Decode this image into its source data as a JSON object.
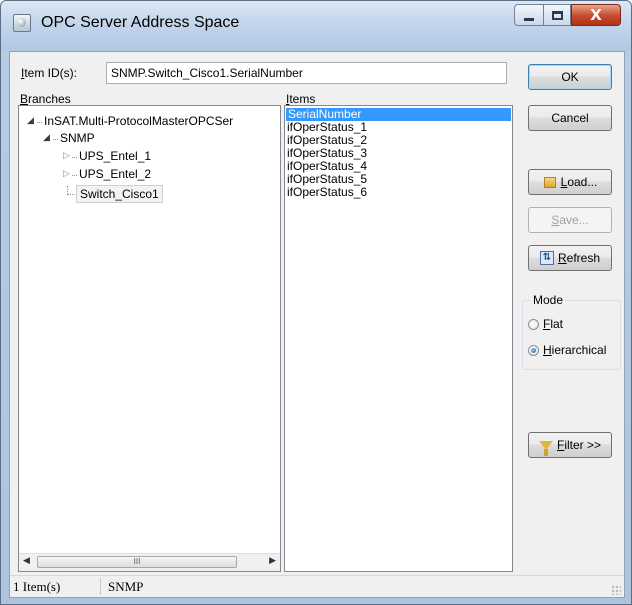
{
  "window": {
    "title": "OPC Server Address Space",
    "controls": {
      "minimize_icon": "minimize-icon",
      "maximize_icon": "maximize-icon",
      "close_glyph": "X"
    }
  },
  "item_id": {
    "label_prefix": "I",
    "label_rest": "tem ID(s):",
    "value": "SNMP.Switch_Cisco1.SerialNumber"
  },
  "branches": {
    "label_prefix": "B",
    "label_rest": "ranches",
    "tree": {
      "root": "InSAT.Multi-ProtocolMasterOPCSer",
      "child": "SNMP",
      "leaves": [
        "UPS_Entel_1",
        "UPS_Entel_2"
      ],
      "selected_leaf": "Switch_Cisco1"
    },
    "scroll_thumb_grip": "III"
  },
  "items": {
    "label_prefix": "I",
    "label_rest": "tems",
    "list": [
      "SerialNumber",
      "ifOperStatus_1",
      "ifOperStatus_2",
      "ifOperStatus_3",
      "ifOperStatus_4",
      "ifOperStatus_5",
      "ifOperStatus_6"
    ],
    "selected_index": 0
  },
  "buttons": {
    "ok": "OK",
    "cancel": "Cancel",
    "load_prefix": "L",
    "load_rest": "oad...",
    "save_prefix": "S",
    "save_rest": "ave...",
    "refresh_prefix": "R",
    "refresh_rest": "efresh",
    "filter_prefix": "F",
    "filter_rest": "ilter >>"
  },
  "mode": {
    "legend": "Mode",
    "flat_prefix": "F",
    "flat_rest": "lat",
    "hier_prefix": "H",
    "hier_rest": "ierarchical",
    "selected": "Hierarchical"
  },
  "status": {
    "count": "1 Item(s)",
    "branch": "SNMP"
  },
  "colors": {
    "selection": "#3399ff",
    "frame": "#b6cbe4",
    "close_button": "#c5492d"
  }
}
